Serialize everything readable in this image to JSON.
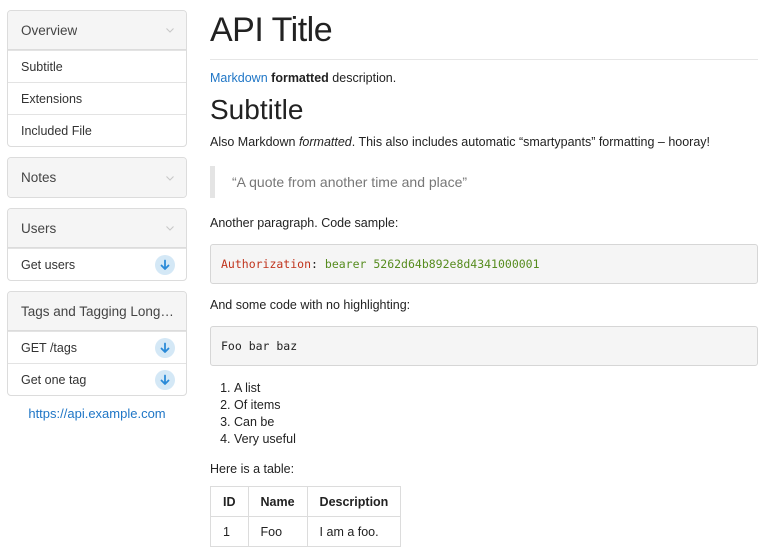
{
  "sidebar": {
    "overview": {
      "label": "Overview",
      "items": [
        {
          "label": "Subtitle"
        },
        {
          "label": "Extensions"
        },
        {
          "label": "Included File"
        }
      ]
    },
    "notes": {
      "label": "Notes"
    },
    "users": {
      "label": "Users",
      "items": [
        {
          "label": "Get users"
        }
      ]
    },
    "tags": {
      "label": "Tags and Tagging Long Ti...",
      "items": [
        {
          "label": "GET /tags"
        },
        {
          "label": "Get one tag"
        }
      ]
    },
    "base_url": "https://api.example.com"
  },
  "main": {
    "title": "API Title",
    "description": {
      "link": "Markdown",
      "bold": "formatted",
      "rest": "description."
    },
    "subtitle": "Subtitle",
    "also": {
      "pre": "Also Markdown ",
      "em": "formatted",
      "post": ". This also includes automatic “smartypants” formatting – hooray!"
    },
    "quote": "“A quote from another time and place”",
    "para_code": "Another paragraph. Code sample:",
    "code1": {
      "key": "Authorization",
      "punct": ":",
      "value": "bearer 5262d64b892e8d4341000001"
    },
    "para_nohl": "And some code with no highlighting:",
    "code2": "Foo bar baz",
    "list": [
      "A list",
      "Of items",
      "Can be",
      "Very useful"
    ],
    "para_table": "Here is a table:",
    "table": {
      "headers": [
        "ID",
        "Name",
        "Description"
      ],
      "rows": [
        [
          "1",
          "Foo",
          "I am a foo."
        ]
      ]
    }
  },
  "colors": {
    "link": "#1f76c6",
    "code_key": "#c0341d",
    "code_value": "#568c1e",
    "download_bg": "#d4e8f6"
  }
}
